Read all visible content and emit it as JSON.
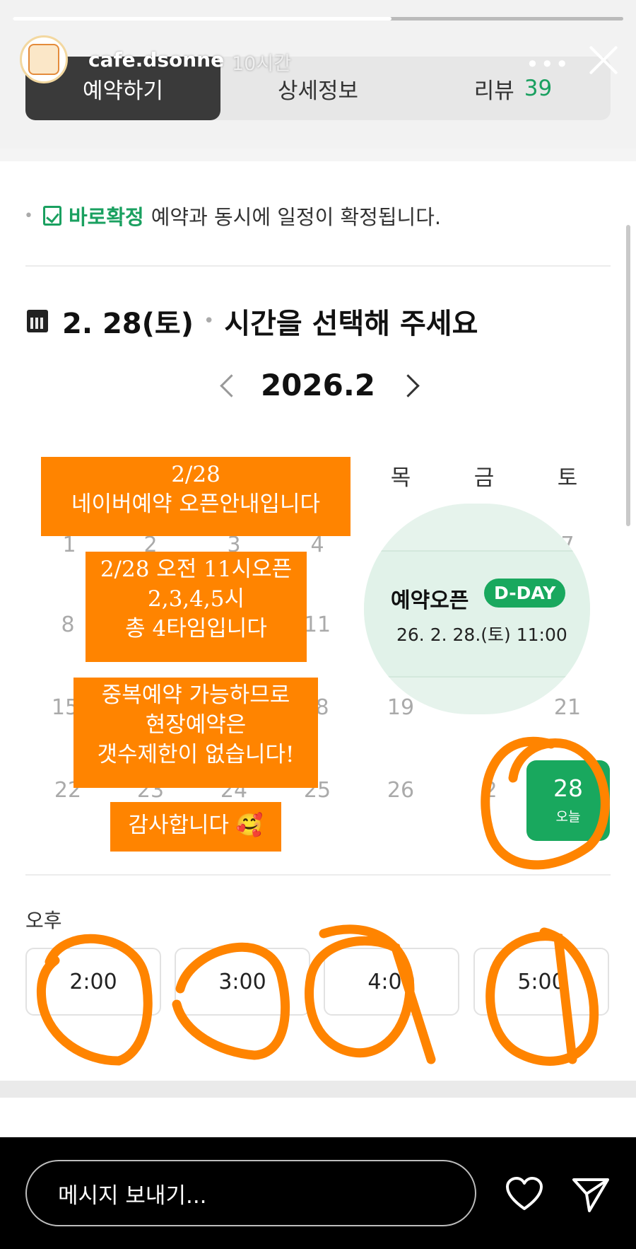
{
  "story": {
    "username": "cafe.dsonne",
    "time_ago": "10시간",
    "progress": 0.62
  },
  "tabs": [
    {
      "label": "예약하기",
      "active": true
    },
    {
      "label": "상세정보",
      "active": false
    },
    {
      "label": "리뷰",
      "count": "39",
      "active": false
    }
  ],
  "notice": {
    "highlight": "바로확정",
    "text": "예약과 동시에 일정이 확정됩니다."
  },
  "date_header": {
    "date": "2. 28(토)",
    "prompt": "시간을 선택해 주세요"
  },
  "calendar": {
    "month": "2026.2",
    "weekdays_visible": [
      "목",
      "금",
      "토"
    ],
    "days": [
      "1",
      "2",
      "3",
      "4",
      "7",
      "8",
      "11",
      "15",
      "8",
      "19",
      "21",
      "22",
      "23",
      "24",
      "25",
      "26",
      "2"
    ],
    "today": {
      "day": "28",
      "label": "오늘"
    }
  },
  "overlay_notes": {
    "note1_line1": "2/28",
    "note1_line2": "네이버예약 오픈안내입니다",
    "note2_line1": "2/28 오전 11시오픈",
    "note2_line2": "2,3,4,5시",
    "note2_line3": "총 4타임입니다",
    "note3_line1": "중복예약 가능하므로",
    "note3_line2": "현장예약은",
    "note3_line3": "갯수제한이 없습니다!",
    "note4": "감사합니다 🥰"
  },
  "dday_sticker": {
    "title": "예약오픈",
    "badge": "D-DAY",
    "datetime": "26. 2. 28.(토) 11:00"
  },
  "times": {
    "section_label": "오후",
    "slots": [
      "2:00",
      "3:00",
      "4:00",
      "5:00"
    ]
  },
  "reply": {
    "placeholder": "메시지 보내기..."
  },
  "colors": {
    "accent_green": "#19a85e",
    "highlight_orange": "#ff8400"
  },
  "icons": [
    "close-icon",
    "more-icon",
    "check-icon",
    "calendar-icon",
    "chevron-left-icon",
    "chevron-right-icon",
    "heart-icon",
    "send-icon"
  ]
}
